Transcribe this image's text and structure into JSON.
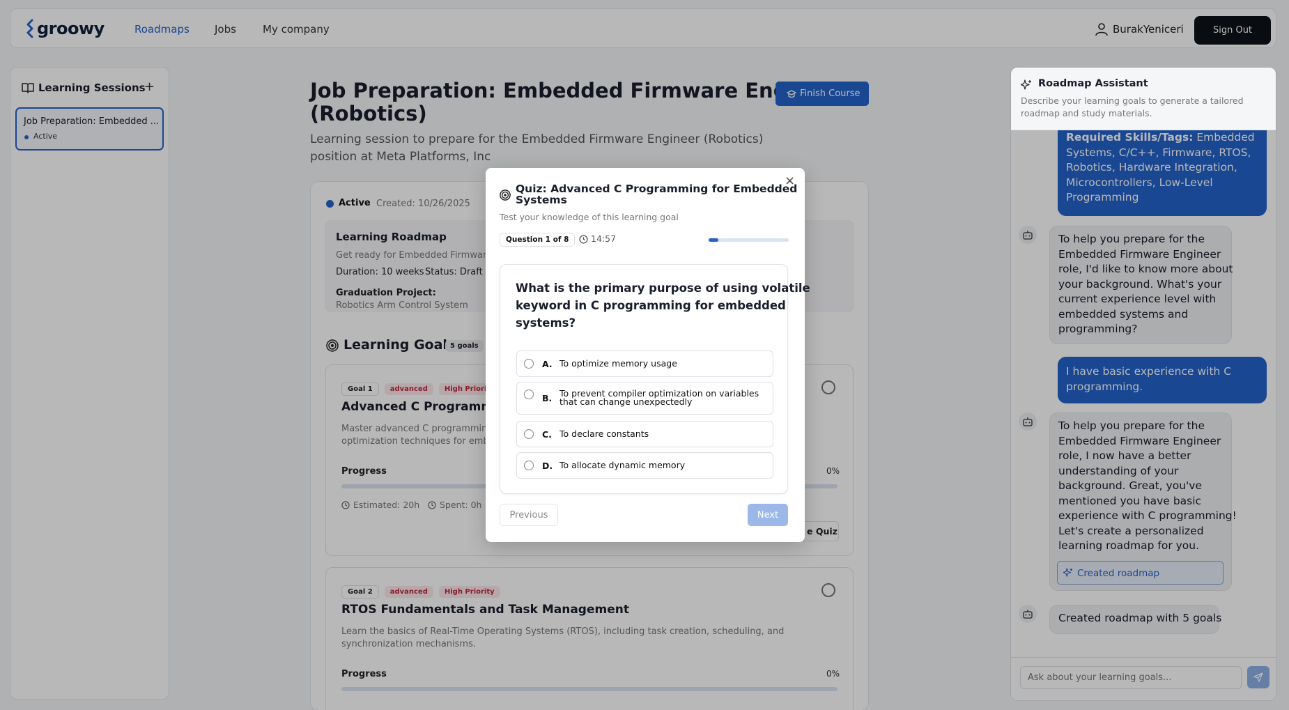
{
  "nav": {
    "logo": "groowy",
    "links": [
      "Roadmaps",
      "Jobs",
      "My company"
    ],
    "username": "BurakYeniceri",
    "signout": "Sign Out"
  },
  "sidebar": {
    "title": "Learning Sessions",
    "add_label": "+",
    "session": {
      "title": "Job Preparation: Embedded ...",
      "status": "Active"
    }
  },
  "main": {
    "title_line1": "Job Preparation: Embedded Firmware Engineer",
    "title_line2": "(Robotics)",
    "subtitle_line1": "Learning session to prepare for the Embedded Firmware Engineer (Robotics)",
    "subtitle_line2": "position at Meta Platforms, Inc",
    "finish_button": "Finish Course",
    "status": "Active",
    "created": "Created: 10/26/2025",
    "roadmap": {
      "title": "Learning Roadmap",
      "desc": "Get ready for Embedded Firmware",
      "duration": "Duration: 10 weeks",
      "status": "Status: Draft",
      "grad_label": "Graduation Project:",
      "grad_value": "Robotics Arm Control System"
    },
    "goals_title": "Learning Goals",
    "goals_count": "5 goals",
    "goals": [
      {
        "tag": "Goal 1",
        "level": "advanced",
        "priority": "High Priori",
        "title": "Advanced C Programmin",
        "desc1": "Master advanced C programmin",
        "desc2": "optimization techniques for emb",
        "progress_label": "Progress",
        "progress_pct": "0%",
        "estimated": "Estimated: 20h",
        "spent": "Spent: 0h",
        "quiz_label": "e Quiz"
      },
      {
        "tag": "Goal 2",
        "level": "advanced",
        "priority": "High Priority",
        "title": "RTOS Fundamentals and Task Management",
        "desc1": "Learn the basics of Real-Time Operating Systems (RTOS), including task creation, scheduling, and",
        "desc2": "synchronization mechanisms.",
        "progress_label": "Progress",
        "progress_pct": "0%"
      }
    ]
  },
  "quiz": {
    "title_line1": "Quiz: Advanced C Programming for Embedded",
    "title_line2": "Systems",
    "subtitle": "Test your knowledge of this learning goal",
    "question_badge": "Question 1 of 8",
    "timer": "14:57",
    "progress_fraction": 0.125,
    "question_line1": "What is the primary purpose of using volatile",
    "question_line2": "keyword in C programming for embedded",
    "question_line3": "systems?",
    "options": [
      {
        "letter": "A.",
        "text1": "To optimize memory usage",
        "text2": ""
      },
      {
        "letter": "B.",
        "text1": "To prevent compiler optimization on variables",
        "text2": "that can change unexpectedly"
      },
      {
        "letter": "C.",
        "text1": "To declare constants",
        "text2": ""
      },
      {
        "letter": "D.",
        "text1": "To allocate dynamic memory",
        "text2": ""
      }
    ],
    "prev": "Previous",
    "next": "Next",
    "close": "×"
  },
  "assistant": {
    "title": "Roadmap Assistant",
    "desc1": "Describe your learning goals to generate a tailored",
    "desc2": "roadmap and study materials.",
    "msg1_bold": "Required Skills/Tags:",
    "msg1_lines": [
      " Embedded",
      "Systems, C/C++, Firmware, RTOS,",
      "Robotics, Hardware Integration,",
      "Microcontrollers, Low-Level",
      "Programming"
    ],
    "msg2_lines": [
      "To help you prepare for the",
      "Embedded Firmware Engineer",
      "role, I'd like to know more about",
      "your background. What's your",
      "current experience level with",
      "embedded systems and",
      "programming?"
    ],
    "msg3_lines": [
      "I have basic experience with C",
      "programming."
    ],
    "msg4_lines": [
      "To help you prepare for the",
      "Embedded Firmware Engineer",
      "role, I now have a better",
      "understanding of your",
      "background. Great, you've",
      "mentioned you have basic",
      "experience with C programming!",
      "Let's create a personalized",
      "learning roadmap for you."
    ],
    "created_button": "Created roadmap",
    "msg5": "Created roadmap with 5 goals",
    "input_placeholder": "Ask about your learning goals..."
  }
}
